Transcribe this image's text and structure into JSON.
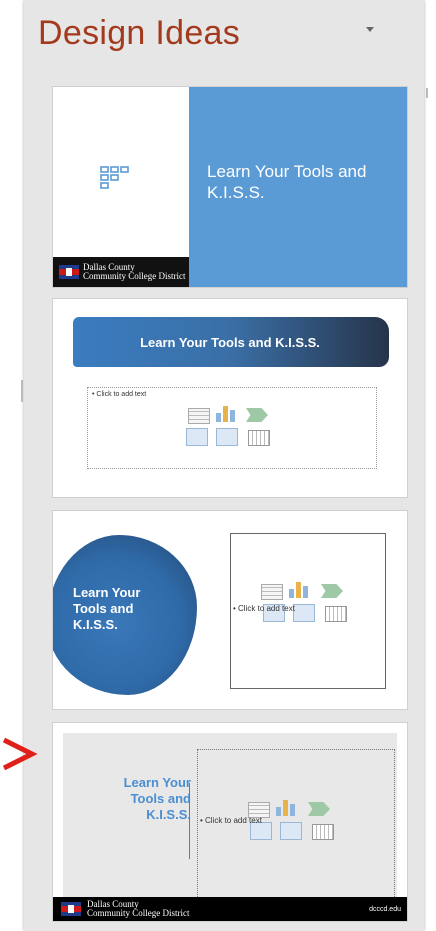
{
  "pane": {
    "title": "Design Ideas",
    "dropdown_icon": "chevron-down-icon"
  },
  "designs": [
    {
      "title": "Learn Your Tools and K.I.S.S.",
      "logo_line1": "Dallas County",
      "logo_line2": "Community College District"
    },
    {
      "title": "Learn Your Tools and K.I.S.S.",
      "placeholder": "Click to add text"
    },
    {
      "title_line1": "Learn Your",
      "title_line2": "Tools and",
      "title_line3": "K.I.S.S.",
      "placeholder": "Click to add text"
    },
    {
      "title_line1": "Learn Your",
      "title_line2": "Tools and",
      "title_line3": "K.I.S.S.",
      "placeholder": "Click to add text",
      "logo_line1": "Dallas County",
      "logo_line2": "Community College District",
      "url": "dcccd.edu"
    }
  ],
  "indicator": {
    "icon": "selection-arrow-icon",
    "color": "#e0201b"
  },
  "colors": {
    "title": "#a33a1e",
    "accent_blue": "#5b9bd5"
  }
}
